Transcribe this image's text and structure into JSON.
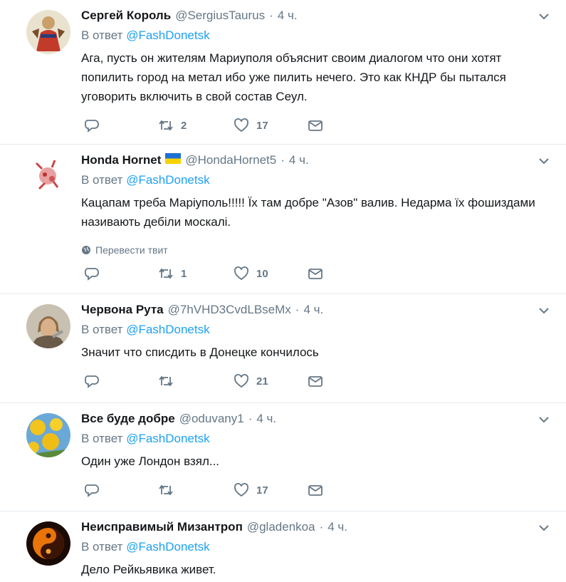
{
  "reply_prefix": "В ответ",
  "tweets": [
    {
      "name": "Сергей Король",
      "handle": "@SergiusTaurus",
      "dot": "·",
      "time": "4 ч.",
      "reply_to": "@FashDonetsk",
      "text": "Ага, пусть он жителям Мариуполя объяснит своим диалогом что они хотят попилить город на метал ибо уже пилить нечего. Это как КНДР бы пытался уговорить включить в свой состав Сеул.",
      "retweets": "2",
      "likes": "17"
    },
    {
      "name": "Honda Hornet",
      "handle": "@HondaHornet5",
      "dot": "·",
      "time": "4 ч.",
      "reply_to": "@FashDonetsk",
      "text": "Кацапам треба Маріуполь!!!!! Їх там добре \"Азов\" валив. Недарма їх фошиздами називають дебіли москалі.",
      "translate": "Перевести твит",
      "retweets": "1",
      "likes": "10"
    },
    {
      "name": "Червона Рута",
      "handle": "@7hVHD3CvdLBseMx",
      "dot": "·",
      "time": "4 ч.",
      "reply_to": "@FashDonetsk",
      "text": "Значит что списдить в Донецке кончилось",
      "retweets": "",
      "likes": "21"
    },
    {
      "name": "Все буде добре",
      "handle": "@oduvany1",
      "dot": "·",
      "time": "4 ч.",
      "reply_to": "@FashDonetsk",
      "text": "Один уже Лондон взял...",
      "retweets": "",
      "likes": "17"
    },
    {
      "name": "Неисправимый Мизантроп",
      "handle": "@gladenkoa",
      "dot": "·",
      "time": "4 ч.",
      "reply_to": "@FashDonetsk",
      "text": "Дело Рейкьявика живет."
    }
  ],
  "colors": {
    "link": "#1da1f2",
    "muted": "#657786",
    "border": "#e6ecf0"
  }
}
